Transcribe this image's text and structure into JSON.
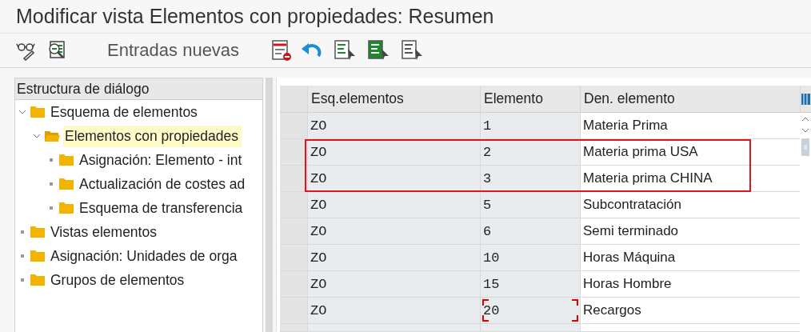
{
  "window": {
    "title": "Modificar vista Elementos con propiedades: Resumen"
  },
  "toolbar": {
    "new_entries_button": "Entradas nuevas"
  },
  "tree": {
    "title": "Estructura de diálogo",
    "items": [
      {
        "label": "Esquema de elementos",
        "expanded": true,
        "selected": false,
        "children": [
          {
            "label": "Elementos con propiedades",
            "expanded": true,
            "selected": true,
            "children": [
              {
                "label": "Asignación: Elemento - int",
                "expanded": false,
                "selected": false
              },
              {
                "label": "Actualización de costes ad",
                "expanded": false,
                "selected": false
              },
              {
                "label": "Esquema de transferencia",
                "expanded": false,
                "selected": false
              }
            ]
          }
        ]
      },
      {
        "label": "Vistas elementos",
        "expanded": false,
        "selected": false
      },
      {
        "label": "Asignación: Unidades de orga",
        "expanded": false,
        "selected": false
      },
      {
        "label": "Grupos de elementos",
        "expanded": false,
        "selected": false
      }
    ]
  },
  "table": {
    "columns": [
      "Esq.elementos",
      "Elemento",
      "Den. elemento"
    ],
    "rows": [
      {
        "cells": [
          "ZO",
          "1",
          "Materia Prima"
        ],
        "marked": false,
        "focused": false
      },
      {
        "cells": [
          "ZO",
          "2",
          "Materia prima USA"
        ],
        "marked": true,
        "focused": false
      },
      {
        "cells": [
          "ZO",
          "3",
          "Materia prima CHINA"
        ],
        "marked": true,
        "focused": false
      },
      {
        "cells": [
          "ZO",
          "5",
          "Subcontratación"
        ],
        "marked": false,
        "focused": false
      },
      {
        "cells": [
          "ZO",
          "6",
          "Semi terminado"
        ],
        "marked": false,
        "focused": false
      },
      {
        "cells": [
          "ZO",
          "10",
          "Horas Máquina"
        ],
        "marked": false,
        "focused": false
      },
      {
        "cells": [
          "ZO",
          "15",
          "Horas Hombre"
        ],
        "marked": false,
        "focused": false
      },
      {
        "cells": [
          "ZO",
          "20",
          "Recargos"
        ],
        "marked": false,
        "focused": true
      }
    ]
  }
}
